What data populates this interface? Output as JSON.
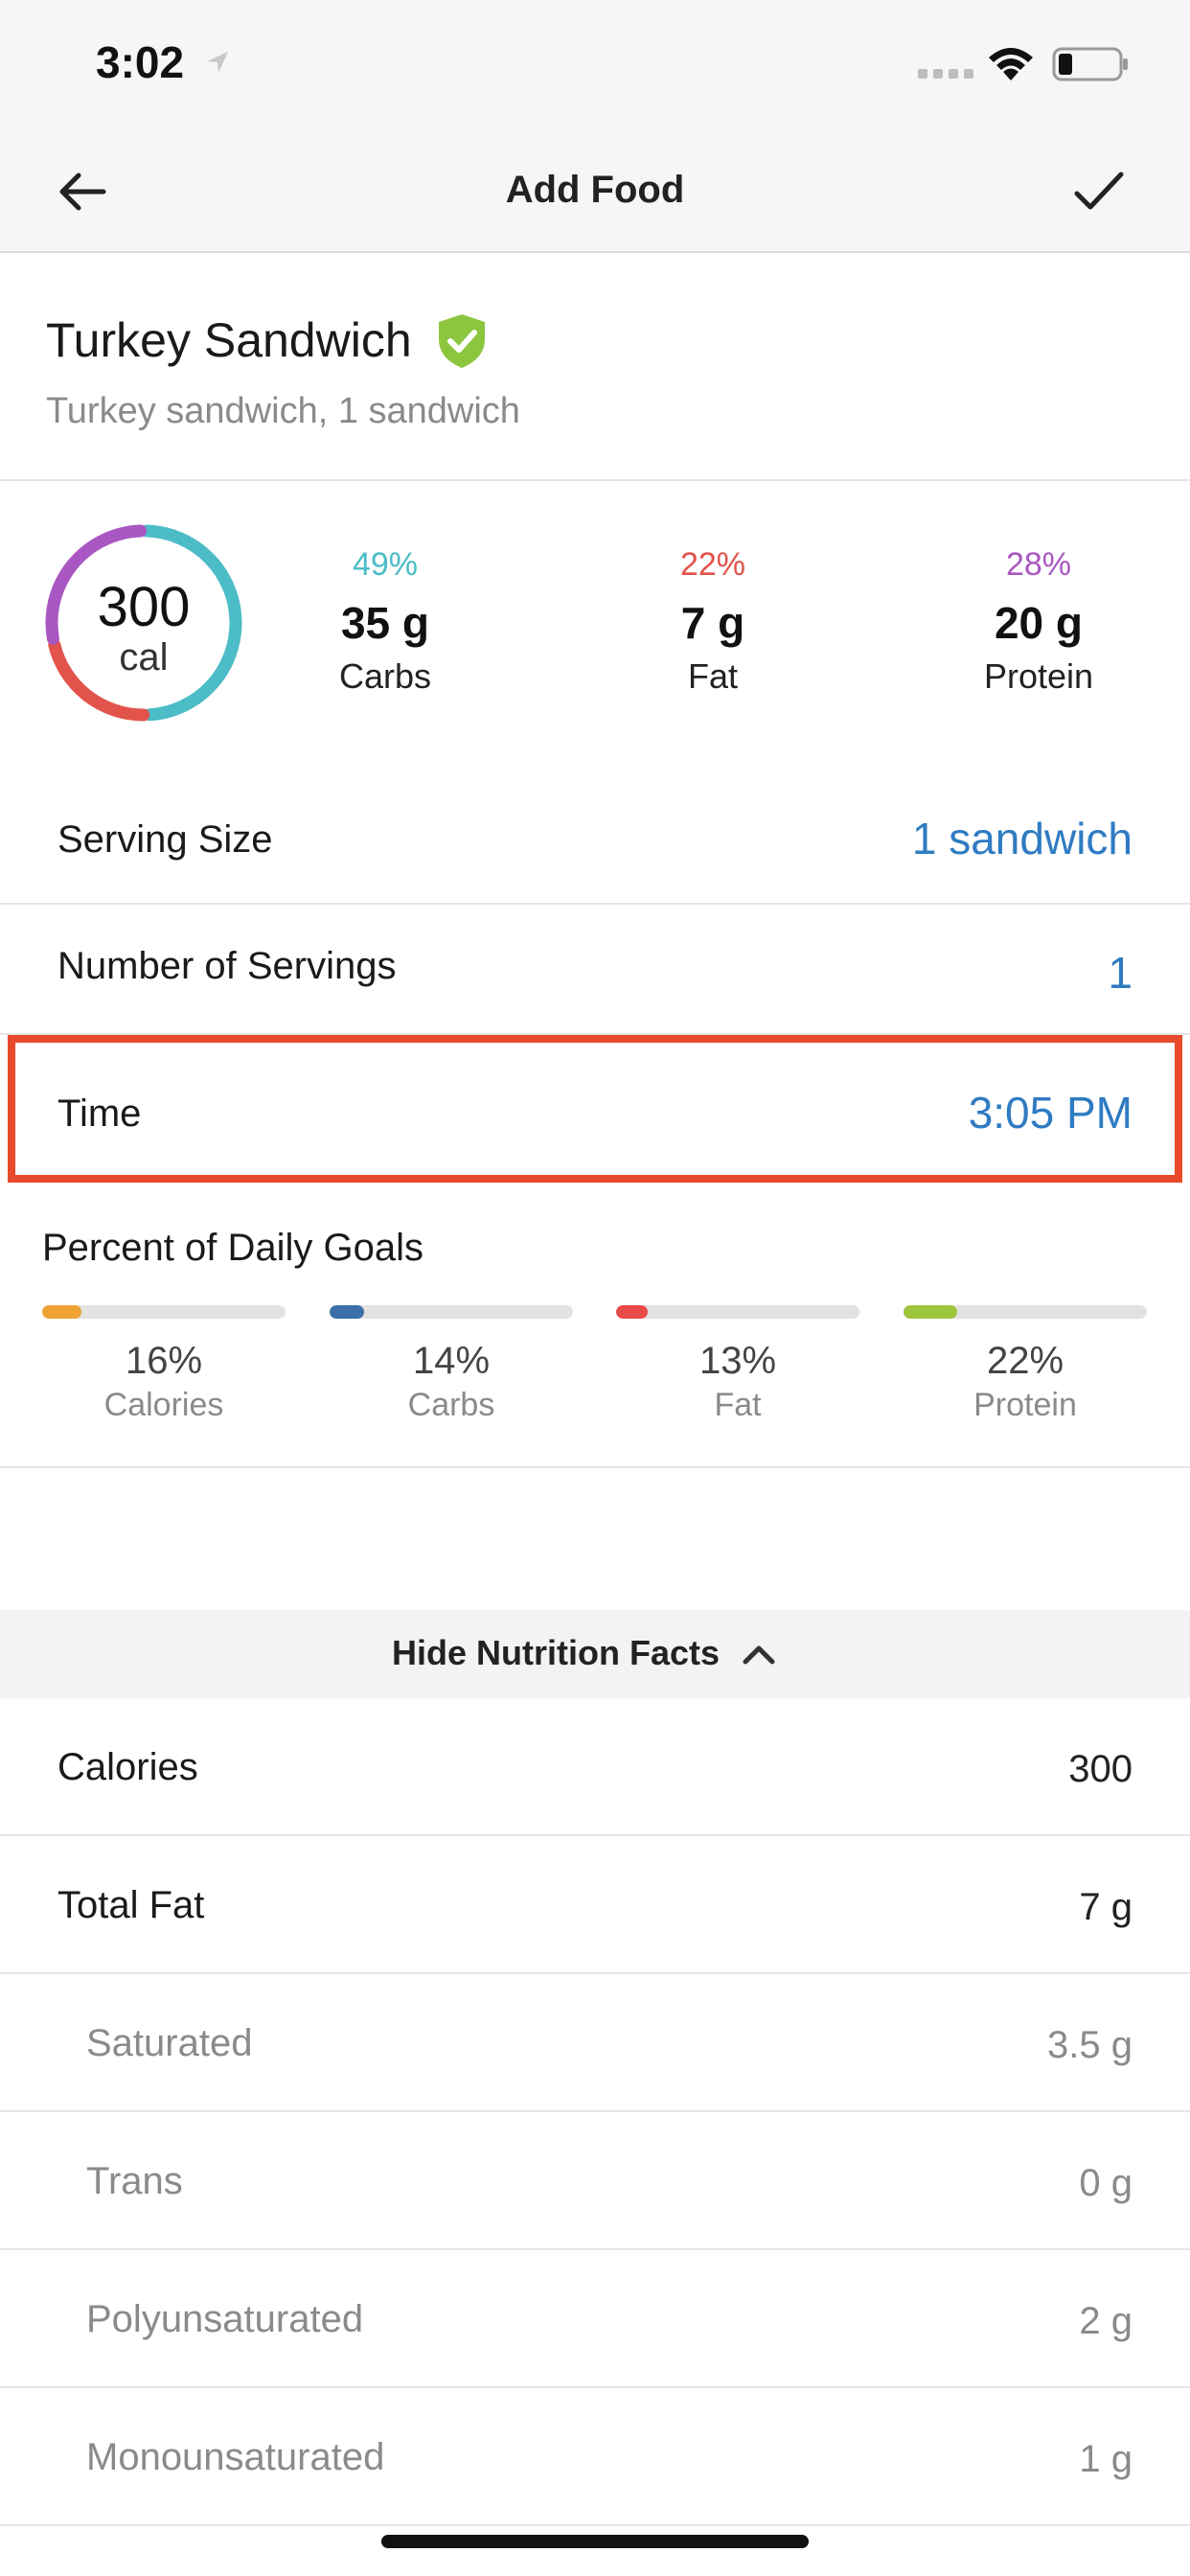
{
  "status_bar": {
    "time": "3:02"
  },
  "nav": {
    "title": "Add Food"
  },
  "food": {
    "name": "Turkey Sandwich",
    "description": "Turkey sandwich, 1 sandwich"
  },
  "macros": {
    "calories": "300",
    "calories_unit": "cal",
    "items": [
      {
        "percent": "49%",
        "value": "35 g",
        "label": "Carbs",
        "color": "#4cbcc7"
      },
      {
        "percent": "22%",
        "value": "7 g",
        "label": "Fat",
        "color": "#e2534b"
      },
      {
        "percent": "28%",
        "value": "20 g",
        "label": "Protein",
        "color": "#a957c2"
      }
    ]
  },
  "settings": {
    "serving_size": {
      "label": "Serving Size",
      "value": "1 sandwich"
    },
    "servings": {
      "label": "Number of Servings",
      "value": "1"
    },
    "time": {
      "label": "Time",
      "value": "3:05 PM"
    }
  },
  "daily_goals": {
    "title": "Percent of Daily Goals",
    "items": [
      {
        "percent": "16%",
        "label": "Calories",
        "fill": 0.16,
        "color": "#f0a233"
      },
      {
        "percent": "14%",
        "label": "Carbs",
        "fill": 0.14,
        "color": "#3c6fa8"
      },
      {
        "percent": "13%",
        "label": "Fat",
        "fill": 0.13,
        "color": "#e84a4a"
      },
      {
        "percent": "22%",
        "label": "Protein",
        "fill": 0.22,
        "color": "#9dc53a"
      }
    ]
  },
  "nutrition": {
    "toggle_label": "Hide Nutrition Facts",
    "rows": [
      {
        "label": "Calories",
        "value": "300"
      },
      {
        "label": "Total Fat",
        "value": "7 g"
      },
      {
        "label": "Saturated",
        "value": "3.5 g"
      },
      {
        "label": "Trans",
        "value": "0 g"
      },
      {
        "label": "Polyunsaturated",
        "value": "2 g"
      },
      {
        "label": "Monounsaturated",
        "value": "1 g"
      }
    ]
  },
  "colors": {
    "accent_blue": "#2f7bc2",
    "highlight": "#e84a2c",
    "verified_green": "#8cc63f"
  }
}
